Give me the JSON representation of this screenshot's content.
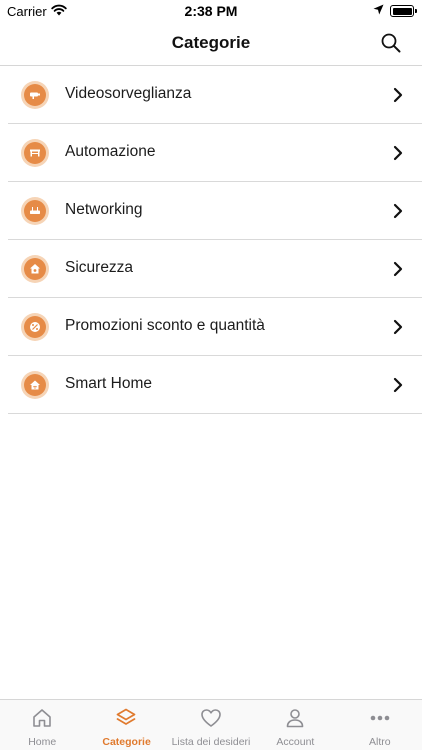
{
  "status_bar": {
    "carrier": "Carrier",
    "time": "2:38 PM"
  },
  "nav": {
    "title": "Categorie"
  },
  "categories": [
    {
      "label": "Videosorveglianza",
      "icon": "camera-icon"
    },
    {
      "label": "Automazione",
      "icon": "gate-icon"
    },
    {
      "label": "Networking",
      "icon": "router-icon"
    },
    {
      "label": "Sicurezza",
      "icon": "home-shield-icon"
    },
    {
      "label": "Promozioni sconto e quantità",
      "icon": "percent-tag-icon"
    },
    {
      "label": "Smart Home",
      "icon": "smart-home-wifi-icon"
    }
  ],
  "tabs": [
    {
      "label": "Home",
      "icon": "home-icon",
      "active": false
    },
    {
      "label": "Categorie",
      "icon": "layers-icon",
      "active": true
    },
    {
      "label": "Lista dei desideri",
      "icon": "heart-icon",
      "active": false
    },
    {
      "label": "Account",
      "icon": "person-icon",
      "active": false
    },
    {
      "label": "Altro",
      "icon": "more-dots-icon",
      "active": false
    }
  ],
  "colors": {
    "accent": "#e07a2e",
    "icon_ring": "#f6d4b6",
    "icon_fill": "#e68b47",
    "inactive_tab": "#8e8e93",
    "divider": "#d9d9d9"
  }
}
